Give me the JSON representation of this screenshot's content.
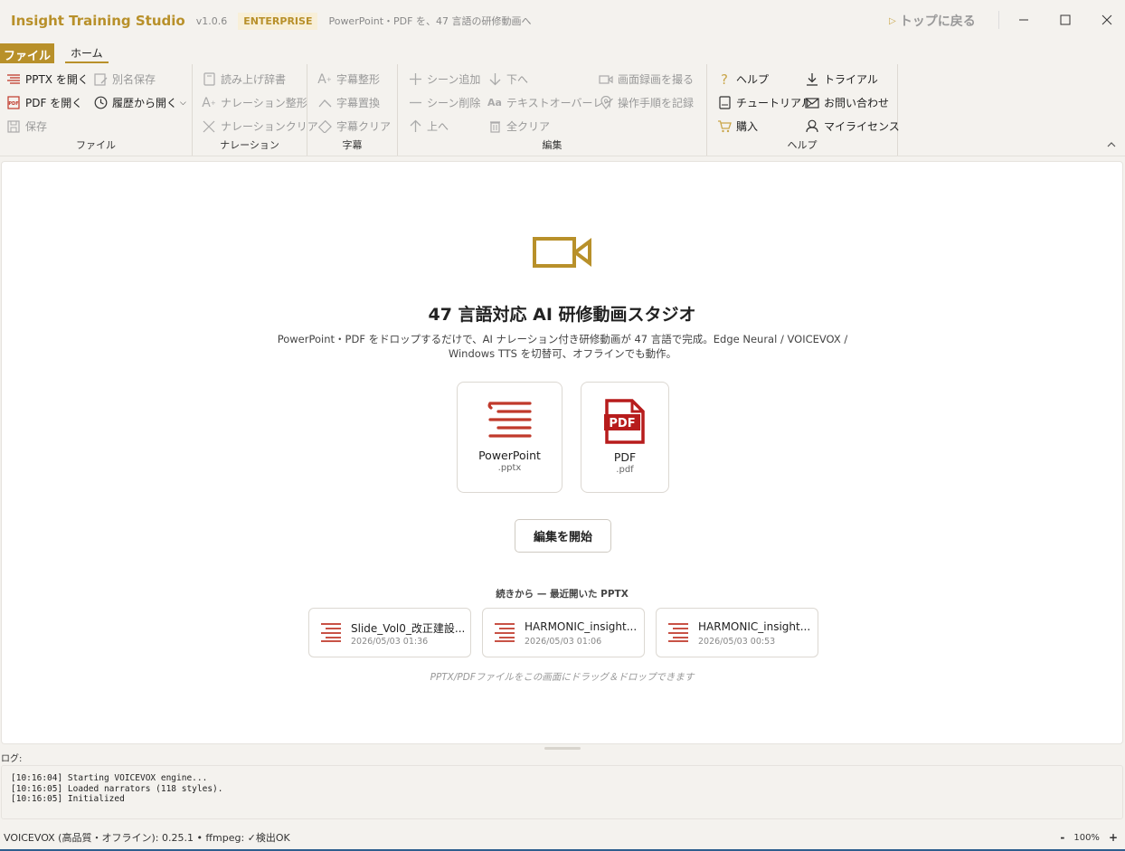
{
  "titlebar": {
    "app_name": "Insight Training Studio",
    "version": "v1.0.6",
    "edition": "ENTERPRISE",
    "tagline": "PowerPoint・PDF を、47 言語の研修動画へ",
    "back_top": "トップに戻る",
    "minimize": "—",
    "maximize": "☐",
    "close": "✕"
  },
  "tabs": {
    "file": "ファイル",
    "home": "ホーム"
  },
  "ribbon": {
    "file_group": {
      "label": "ファイル",
      "open_pptx": "PPTX を開く",
      "open_pdf": "PDF を開く",
      "save": "保存",
      "save_as": "別名保存",
      "open_history": "履歴から開く"
    },
    "narration_group": {
      "label": "ナレーション",
      "dictionary": "読み上げ辞書",
      "shape": "ナレーション整形",
      "clear": "ナレーションクリア"
    },
    "subtitle_group": {
      "label": "字幕",
      "shape": "字幕整形",
      "replace": "字幕置換",
      "clear": "字幕クリア"
    },
    "edit_group": {
      "label": "編集",
      "add_scene": "シーン追加",
      "delete_scene": "シーン削除",
      "up": "上へ",
      "down": "下へ",
      "text_overlay": "テキストオーバーレイ",
      "clear_all": "全クリア",
      "screen_record": "画面録画を撮る",
      "record_steps": "操作手順を記録"
    },
    "help_group": {
      "label": "ヘルプ",
      "help": "ヘルプ",
      "tutorial": "チュートリアル",
      "purchase": "購入",
      "trial": "トライアル",
      "contact": "お問い合わせ",
      "my_license": "マイライセンス"
    }
  },
  "main": {
    "title": "47 言語対応 AI 研修動画スタジオ",
    "desc_line1": "PowerPoint・PDF をドロップするだけで、AI ナレーション付き研修動画が 47 言語で完成。Edge Neural / VOICEVOX /",
    "desc_line2": "Windows TTS を切替可、オフラインでも動作。",
    "cards": [
      {
        "name": "PowerPoint",
        "ext": ".pptx"
      },
      {
        "name": "PDF",
        "ext": ".pdf"
      }
    ],
    "start_button": "編集を開始",
    "recent_title": "続きから — 最近開いた PPTX",
    "recent": [
      {
        "name": "Slide_Vol0_改正建設...",
        "date": "2026/05/03 01:36"
      },
      {
        "name": "HARMONIC_insight...",
        "date": "2026/05/03 01:06"
      },
      {
        "name": "HARMONIC_insight...",
        "date": "2026/05/03 00:53"
      }
    ],
    "drop_hint": "PPTX/PDFファイルをこの画面にドラッグ＆ドロップできます"
  },
  "log": {
    "label": "ログ:",
    "lines": [
      "[10:16:04] Starting VOICEVOX engine...",
      "[10:16:05] Loaded narrators (118 styles).",
      "[10:16:05] Initialized"
    ]
  },
  "status": {
    "text": "VOICEVOX (高品質・オフライン): 0.25.1 • ffmpeg: ✓検出OK",
    "zoom_out": "-",
    "zoom": "100%",
    "zoom_in": "+"
  },
  "colors": {
    "accent": "#b8902a",
    "pptx": "#c0392b",
    "pdf": "#b71c1c"
  }
}
